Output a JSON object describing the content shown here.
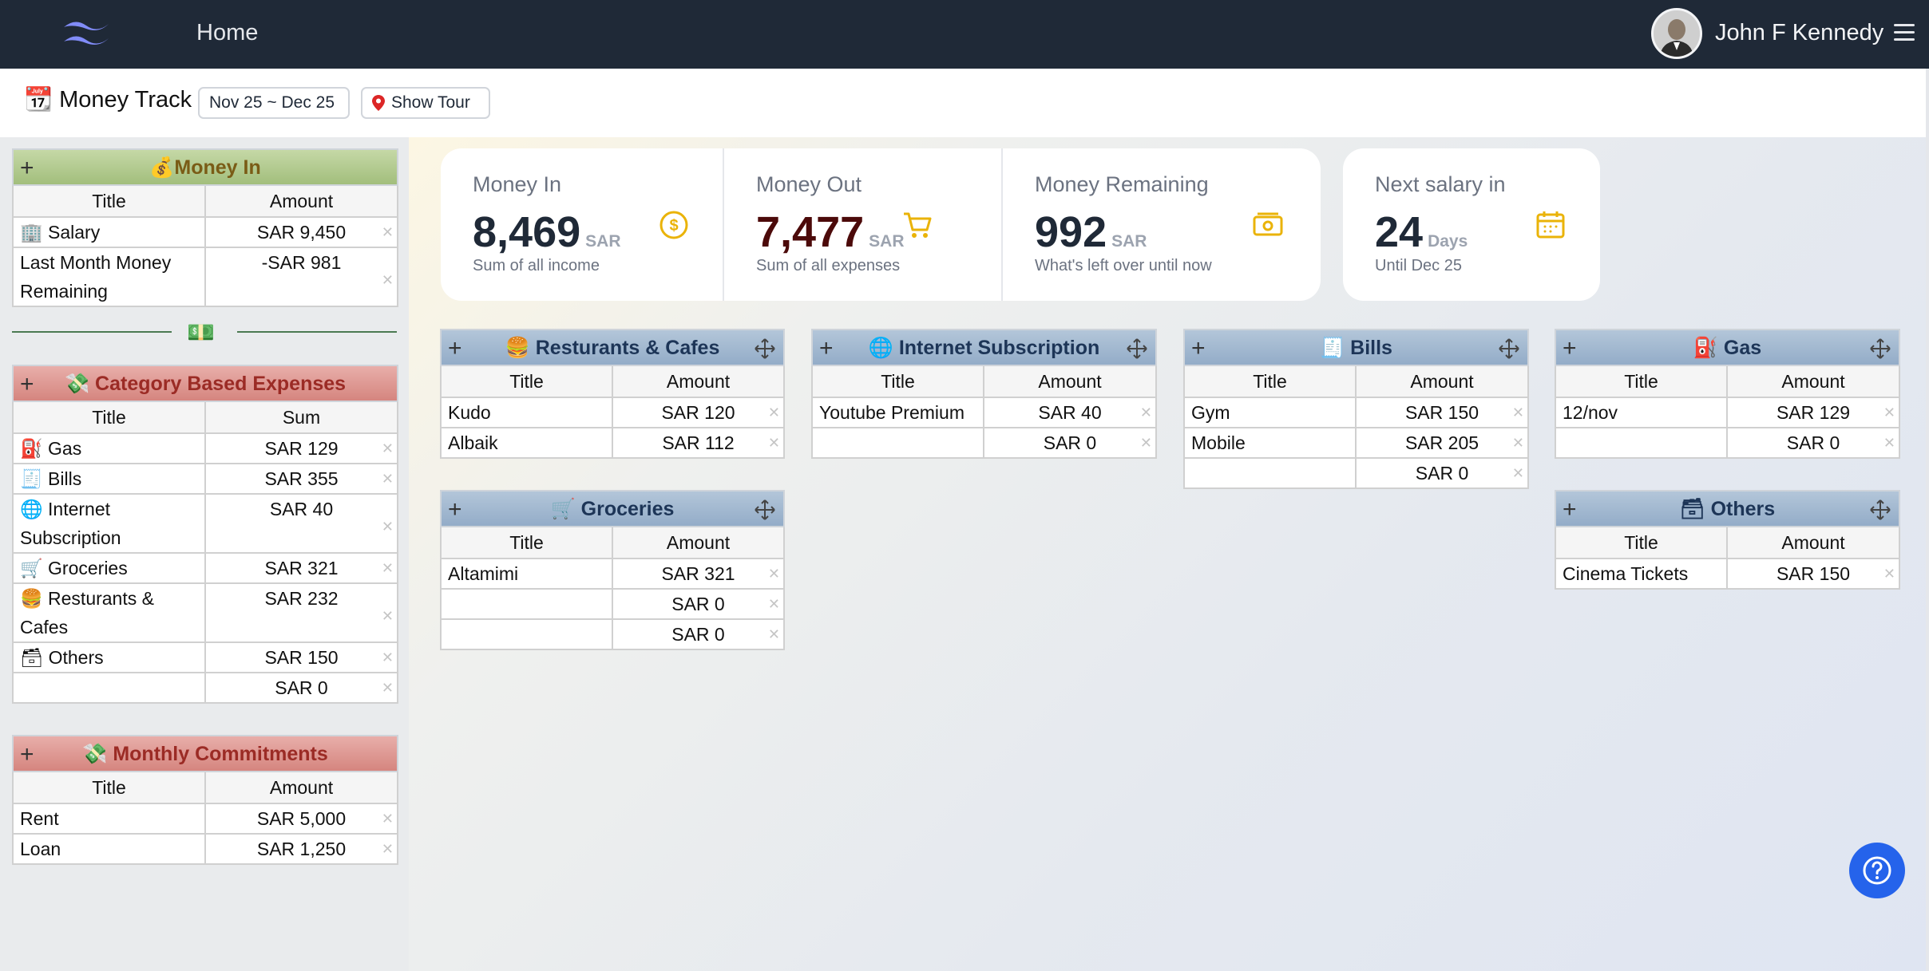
{
  "nav": {
    "home": "Home",
    "user_name": "John F Kennedy"
  },
  "subbar": {
    "icon": "📆",
    "title": "Money Track",
    "date_range": "Nov 25 ~ Dec 25",
    "tour": "Show Tour"
  },
  "money_in": {
    "icon": "💰",
    "title": "Money In",
    "columns": [
      "Title",
      "Amount"
    ],
    "rows": [
      {
        "title": "🏢 Salary",
        "amount": "SAR 9,450"
      },
      {
        "title": "Last Month Money Remaining",
        "amount": "-SAR 981"
      }
    ]
  },
  "separator_icon": "💵",
  "category_expenses": {
    "icon": "💸",
    "title": "Category Based Expenses",
    "columns": [
      "Title",
      "Sum"
    ],
    "rows": [
      {
        "title": "⛽ Gas",
        "amount": "SAR 129"
      },
      {
        "title": "🧾 Bills",
        "amount": "SAR 355"
      },
      {
        "title": "🌐 Internet Subscription",
        "amount": "SAR 40"
      },
      {
        "title": "🛒 Groceries",
        "amount": "SAR 321"
      },
      {
        "title": "🍔 Resturants & Cafes",
        "amount": "SAR 232"
      },
      {
        "title": "🗃 Others",
        "amount": "SAR 150"
      },
      {
        "title": "",
        "amount": "SAR 0"
      }
    ]
  },
  "commitments": {
    "icon": "💸",
    "title": "Monthly Commitments",
    "columns": [
      "Title",
      "Amount"
    ],
    "rows": [
      {
        "title": "Rent",
        "amount": "SAR 5,000"
      },
      {
        "title": "Loan",
        "amount": "SAR 1,250"
      }
    ]
  },
  "stats": {
    "money_in": {
      "label": "Money In",
      "value": "8,469",
      "unit": "SAR",
      "desc": "Sum of all income",
      "icon": "dollar-circle-icon"
    },
    "money_out": {
      "label": "Money Out",
      "value": "7,477",
      "unit": "SAR",
      "desc": "Sum of all expenses",
      "icon": "cart-icon"
    },
    "remaining": {
      "label": "Money Remaining",
      "value": "992",
      "unit": "SAR",
      "desc": "What's left over until now",
      "icon": "cash-icon"
    },
    "salary": {
      "label": "Next salary in",
      "value": "24",
      "unit": "Days",
      "desc": "Until Dec 25",
      "icon": "calendar-icon"
    }
  },
  "cards": {
    "restaurants": {
      "icon": "🍔",
      "title": "Resturants & Cafes",
      "columns": [
        "Title",
        "Amount"
      ],
      "rows": [
        {
          "title": "Kudo",
          "amount": "SAR 120"
        },
        {
          "title": "Albaik",
          "amount": "SAR 112"
        }
      ]
    },
    "internet": {
      "icon": "🌐",
      "title": "Internet Subscription",
      "columns": [
        "Title",
        "Amount"
      ],
      "rows": [
        {
          "title": "Youtube Premium",
          "amount": "SAR 40"
        },
        {
          "title": "",
          "amount": "SAR 0"
        }
      ]
    },
    "bills": {
      "icon": "🧾",
      "title": "Bills",
      "columns": [
        "Title",
        "Amount"
      ],
      "rows": [
        {
          "title": "Gym",
          "amount": "SAR 150"
        },
        {
          "title": "Mobile",
          "amount": "SAR 205"
        },
        {
          "title": "",
          "amount": "SAR 0"
        }
      ]
    },
    "gas": {
      "icon": "⛽",
      "title": "Gas",
      "columns": [
        "Title",
        "Amount"
      ],
      "rows": [
        {
          "title": "12/nov",
          "amount": "SAR 129"
        },
        {
          "title": "",
          "amount": "SAR 0"
        }
      ]
    },
    "groceries": {
      "icon": "🛒",
      "title": "Groceries",
      "columns": [
        "Title",
        "Amount"
      ],
      "rows": [
        {
          "title": "Altamimi",
          "amount": "SAR 321"
        },
        {
          "title": "",
          "amount": "SAR 0"
        },
        {
          "title": "",
          "amount": "SAR 0"
        }
      ]
    },
    "others": {
      "icon": "🗃",
      "title": "Others",
      "columns": [
        "Title",
        "Amount"
      ],
      "rows": [
        {
          "title": "Cinema Tickets",
          "amount": "SAR 150"
        }
      ]
    }
  },
  "colors": {
    "accent_green": "#a2be7c",
    "accent_red": "#d5857f",
    "accent_blue": "#93acc8",
    "stat_icon": "#eab308",
    "help_button": "#2563eb"
  }
}
